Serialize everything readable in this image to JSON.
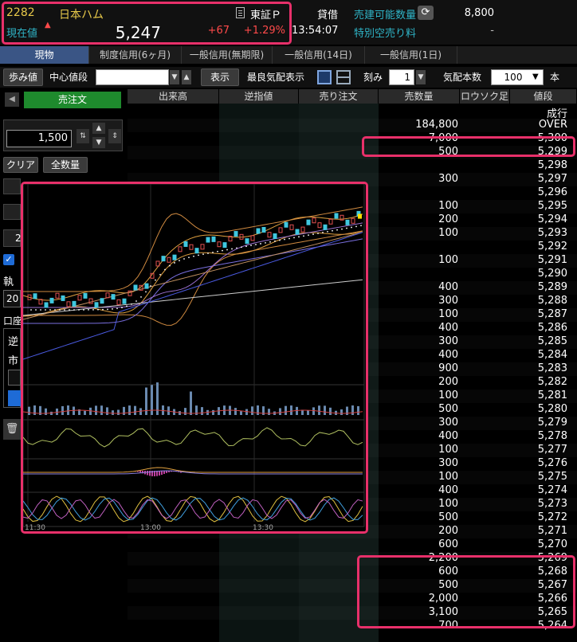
{
  "header": {
    "stock_code": "2282",
    "stock_name": "日本ハム",
    "current_label": "現在値",
    "current_price": "5,247",
    "change": "+67",
    "change_pct": "+1.29%",
    "market": "東証Ｐ",
    "time": "13:54:07",
    "taishaku": "貸借",
    "sellable_label": "売建可能数量",
    "sellable_qty": "8,800",
    "tokubetsu_label": "特別空売り料",
    "tokubetsu_value": "-"
  },
  "tabs": [
    "現物",
    "制度信用(6ヶ月)",
    "一般信用(無期限)",
    "一般信用(14日)",
    "一般信用(1日)"
  ],
  "toolbar": {
    "ayumine": "歩み値",
    "center_price_label": "中心値段",
    "center_price_value": "",
    "show_button": "表示",
    "best_quote_label": "最良気配表示",
    "tick_label": "刻み",
    "tick_value": "1",
    "depth_label": "気配本数",
    "depth_value": "100",
    "depth_unit": "本"
  },
  "left": {
    "sell_order_button": "売注文",
    "quantity": "1,500",
    "clear_button": "クリア",
    "all_qty_button": "全数量",
    "exec_label": "執",
    "num_fragment": "20",
    "kouza_fragment": "口座",
    "gyaku_fragment": "逆",
    "ichi_fragment": "市",
    "num2_fragment": "2"
  },
  "book": {
    "headers": [
      "出来高",
      "逆指値",
      "売り注文",
      "売数量",
      "ロウソク足",
      "値段"
    ],
    "special_rows": [
      {
        "qty": "",
        "price": "成行"
      },
      {
        "qty": "184,800",
        "price": "OVER"
      }
    ],
    "rows": [
      {
        "qty": "7,000",
        "price": "5,300"
      },
      {
        "qty": "500",
        "price": "5,299"
      },
      {
        "qty": "",
        "price": "5,298"
      },
      {
        "qty": "300",
        "price": "5,297"
      },
      {
        "qty": "",
        "price": "5,296"
      },
      {
        "qty": "100",
        "price": "5,295"
      },
      {
        "qty": "200",
        "price": "5,294"
      },
      {
        "qty": "100",
        "price": "5,293"
      },
      {
        "qty": "",
        "price": "5,292"
      },
      {
        "qty": "100",
        "price": "5,291"
      },
      {
        "qty": "",
        "price": "5,290"
      },
      {
        "qty": "400",
        "price": "5,289"
      },
      {
        "qty": "300",
        "price": "5,288"
      },
      {
        "qty": "100",
        "price": "5,287"
      },
      {
        "qty": "400",
        "price": "5,286"
      },
      {
        "qty": "300",
        "price": "5,285"
      },
      {
        "qty": "400",
        "price": "5,284"
      },
      {
        "qty": "900",
        "price": "5,283"
      },
      {
        "qty": "200",
        "price": "5,282"
      },
      {
        "qty": "100",
        "price": "5,281"
      },
      {
        "qty": "500",
        "price": "5,280"
      },
      {
        "qty": "300",
        "price": "5,279"
      },
      {
        "qty": "400",
        "price": "5,278"
      },
      {
        "qty": "100",
        "price": "5,277"
      },
      {
        "qty": "300",
        "price": "5,276"
      },
      {
        "qty": "100",
        "price": "5,275"
      },
      {
        "qty": "400",
        "price": "5,274"
      },
      {
        "qty": "100",
        "price": "5,273"
      },
      {
        "qty": "500",
        "price": "5,272"
      },
      {
        "qty": "200",
        "price": "5,271"
      },
      {
        "qty": "600",
        "price": "5,270"
      },
      {
        "qty": "2,200",
        "price": "5,269"
      },
      {
        "qty": "600",
        "price": "5,268"
      },
      {
        "qty": "500",
        "price": "5,267"
      },
      {
        "qty": "2,000",
        "price": "5,266"
      },
      {
        "qty": "3,100",
        "price": "5,265"
      },
      {
        "qty": "700",
        "price": "5,264"
      }
    ]
  },
  "chart": {
    "time_labels": [
      "11:30",
      "13:00",
      "13:30"
    ]
  },
  "colors": {
    "accent_highlight": "#e8306a",
    "up_red": "#ff4a4a",
    "label_cyan": "#2fb5c8",
    "code_yellow": "#e8c94a",
    "sell_green": "#1e8a2d"
  }
}
